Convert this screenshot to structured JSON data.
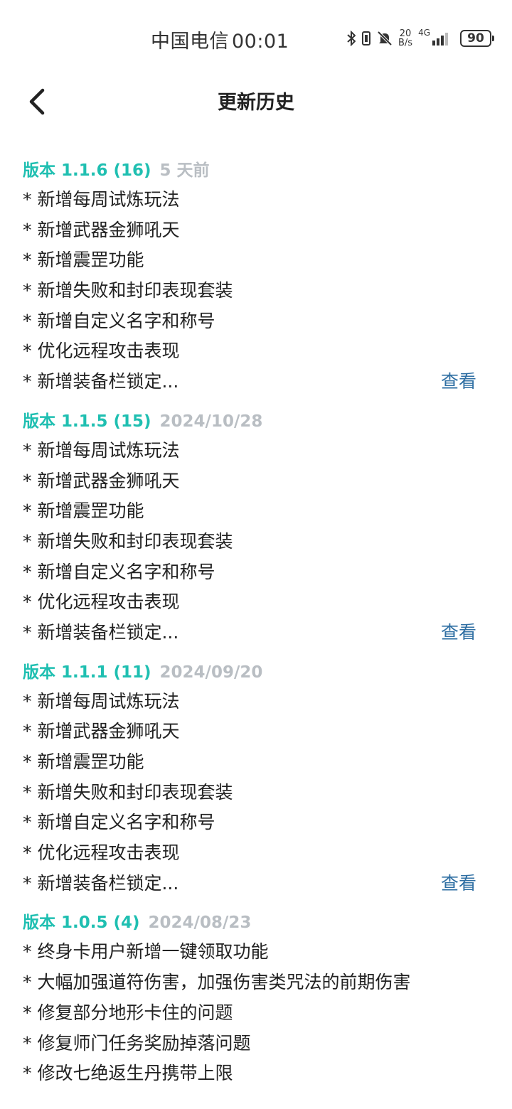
{
  "status_bar": {
    "carrier": "中国电信",
    "time": "00:01",
    "net_speed_value": "20",
    "net_speed_unit": "B/s",
    "network_type": "4G",
    "battery": "90"
  },
  "header": {
    "title": "更新历史"
  },
  "versions": [
    {
      "label": "版本 1.1.6 (16)",
      "date": "5 天前",
      "changes": [
        "* 新增每周试炼玩法",
        "* 新增武器金狮吼天",
        "* 新增震罡功能",
        "* 新增失败和封印表现套装",
        "* 新增自定义名字和称号",
        "* 优化远程攻击表现",
        "* 新增装备栏锁定..."
      ],
      "view_label": "查看"
    },
    {
      "label": "版本 1.1.5 (15)",
      "date": "2024/10/28",
      "changes": [
        "* 新增每周试炼玩法",
        "* 新增武器金狮吼天",
        "* 新增震罡功能",
        "* 新增失败和封印表现套装",
        "* 新增自定义名字和称号",
        "* 优化远程攻击表现",
        "* 新增装备栏锁定..."
      ],
      "view_label": "查看"
    },
    {
      "label": "版本 1.1.1 (11)",
      "date": "2024/09/20",
      "changes": [
        "* 新增每周试炼玩法",
        "* 新增武器金狮吼天",
        "* 新增震罡功能",
        "* 新增失败和封印表现套装",
        "* 新增自定义名字和称号",
        "* 优化远程攻击表现",
        "* 新增装备栏锁定..."
      ],
      "view_label": "查看"
    },
    {
      "label": "版本 1.0.5 (4)",
      "date": "2024/08/23",
      "changes": [
        "* 终身卡用户新增一键领取功能",
        "* 大幅加强道符伤害，加强伤害类咒法的前期伤害",
        "* 修复部分地形卡住的问题",
        "* 修复师门任务奖励掉落问题",
        "* 修改七绝返生丹携带上限"
      ]
    }
  ]
}
